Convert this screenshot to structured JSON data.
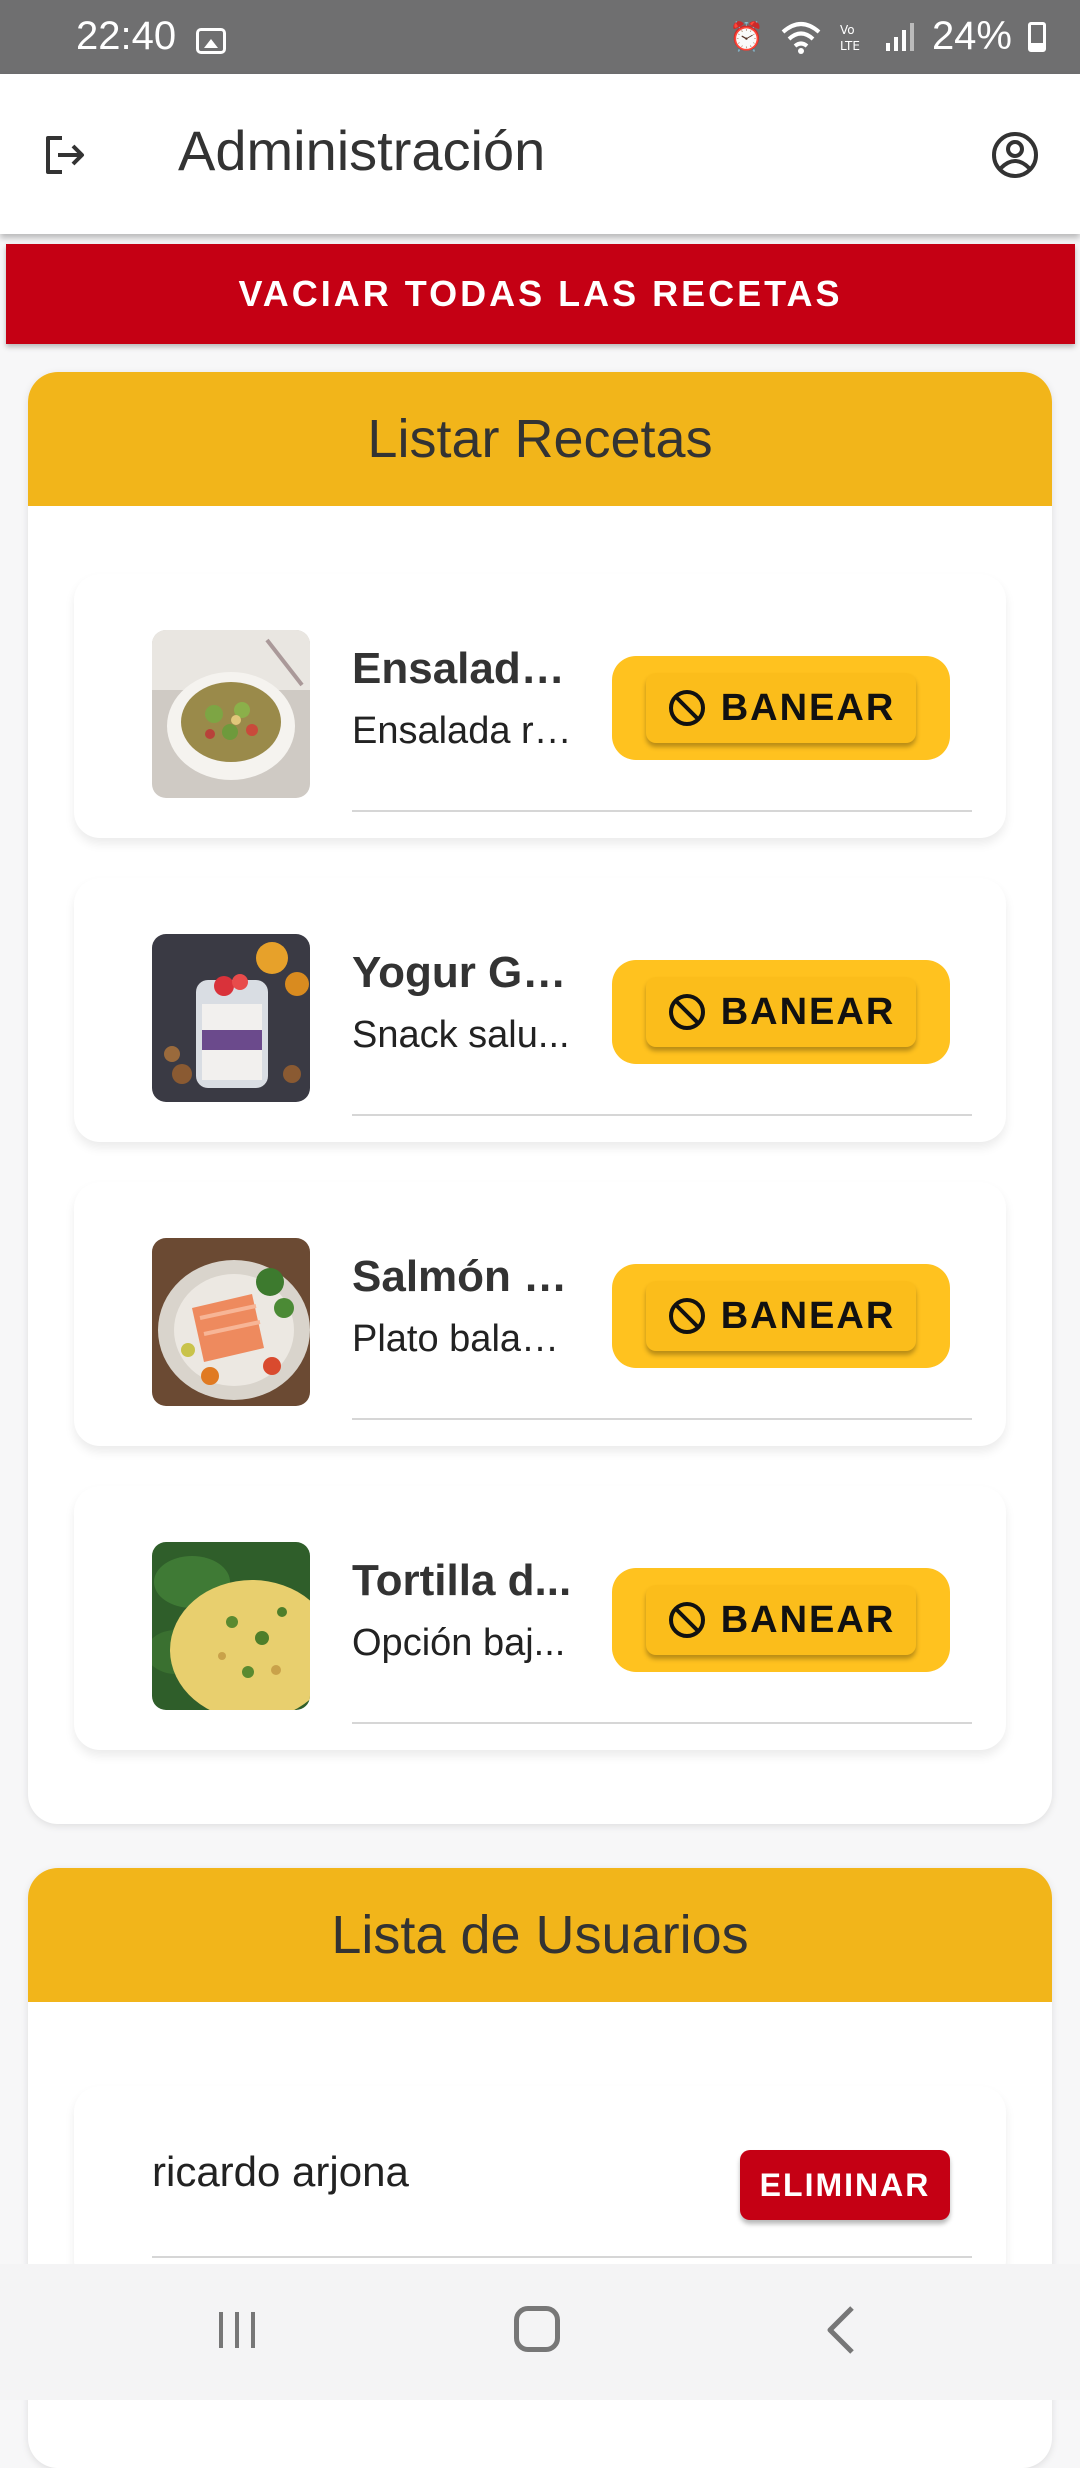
{
  "status_bar": {
    "time": "22:40",
    "battery": "24%",
    "icons": [
      "image-icon",
      "alarm-icon",
      "wifi-icon",
      "volte-icon",
      "signal-icon",
      "battery-icon"
    ]
  },
  "app_bar": {
    "title": "Administración",
    "left_icon": "logout-icon",
    "right_icon": "account-circle-icon"
  },
  "clear_button": {
    "label": "VACIAR TODAS LAS RECETAS",
    "color": "#c50014"
  },
  "recipes_section": {
    "title": "Listar Recetas",
    "header_color": "#f2b51a",
    "ban_label": "BANEAR",
    "items": [
      {
        "title": "Ensalada ...",
        "description": "Ensalada ri...",
        "image": "salad-bowl"
      },
      {
        "title": "Yogur Gri...",
        "description": "Snack salu...",
        "image": "yogurt-jar"
      },
      {
        "title": "Salmón a...",
        "description": "Plato balan...",
        "image": "salmon-plate"
      },
      {
        "title": "Tortilla d...",
        "description": "Opción baj...",
        "image": "spinach-tortilla"
      }
    ]
  },
  "users_section": {
    "title": "Lista de Usuarios",
    "delete_label": "ELIMINAR",
    "users": [
      {
        "name": "ricardo arjona"
      }
    ]
  },
  "nav_bar": {
    "icons": [
      "recent-apps-icon",
      "home-icon",
      "back-icon"
    ]
  }
}
